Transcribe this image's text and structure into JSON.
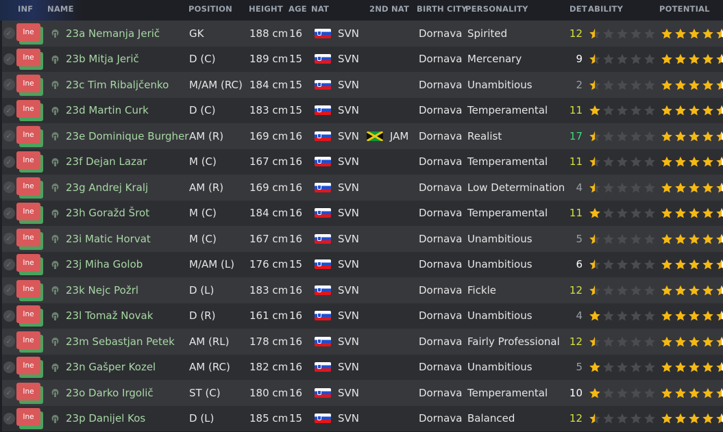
{
  "header": {
    "inf": "INF",
    "name": "NAME",
    "position": "POSITION",
    "height": "HEIGHT",
    "age": "AGE",
    "nat": "NAT",
    "nat2": "2ND NAT",
    "birth_city": "BIRTH CITY",
    "personality": "PERSONALITY",
    "det": "DET",
    "ability": "ABILITY",
    "potential": "POTENTIAL"
  },
  "colors": {
    "det_high": "#3fdc7a",
    "det_mid": "#d4e23c",
    "det_low": "#9aa0a6",
    "det_neutral": "#ffffff",
    "star_gold": "#f5b914",
    "star_empty": "#4a4c50",
    "star_white": "#ffffff",
    "name_green": "#a8d8a5",
    "inf_badge": "#d9585a"
  },
  "players": [
    {
      "inf": "Ine",
      "name": "23a Nemanja Jerič",
      "position": "GK",
      "height": "188 cm",
      "age": "16",
      "nat": "SVN",
      "nat2": "",
      "city": "Dornava",
      "personality": "Spirited",
      "det": "12",
      "det_tone": "mid",
      "ability_stars": 0.5,
      "potential_stars": 4.5
    },
    {
      "inf": "Ine",
      "name": "23b Mitja Jerič",
      "position": "D (C)",
      "height": "189 cm",
      "age": "15",
      "nat": "SVN",
      "nat2": "",
      "city": "Dornava",
      "personality": "Mercenary",
      "det": "9",
      "det_tone": "neutral",
      "ability_stars": 0.5,
      "potential_stars": 4.5
    },
    {
      "inf": "Ine",
      "name": "23c Tim Ribaljčenko",
      "position": "M/AM (RC)",
      "height": "184 cm",
      "age": "15",
      "nat": "SVN",
      "nat2": "",
      "city": "Dornava",
      "personality": "Unambitious",
      "det": "2",
      "det_tone": "low",
      "ability_stars": 0.5,
      "potential_stars": 4.5
    },
    {
      "inf": "Ine",
      "name": "23d Martin Curk",
      "position": "D (C)",
      "height": "183 cm",
      "age": "15",
      "nat": "SVN",
      "nat2": "",
      "city": "Dornava",
      "personality": "Temperamental",
      "det": "11",
      "det_tone": "mid",
      "ability_stars": 1,
      "potential_stars": 4.5
    },
    {
      "inf": "Ine",
      "name": "23e Dominique Burgher",
      "position": "AM (R)",
      "height": "169 cm",
      "age": "16",
      "nat": "SVN",
      "nat2": "JAM",
      "city": "Dornava",
      "personality": "Realist",
      "det": "17",
      "det_tone": "high",
      "ability_stars": 0.5,
      "potential_stars": 4.5
    },
    {
      "inf": "Ine",
      "name": "23f Dejan Lazar",
      "position": "M (C)",
      "height": "167 cm",
      "age": "16",
      "nat": "SVN",
      "nat2": "",
      "city": "Dornava",
      "personality": "Temperamental",
      "det": "11",
      "det_tone": "mid",
      "ability_stars": 0.5,
      "potential_stars": 4.5
    },
    {
      "inf": "Ine",
      "name": "23g Andrej Kralj",
      "position": "AM (R)",
      "height": "169 cm",
      "age": "16",
      "nat": "SVN",
      "nat2": "",
      "city": "Dornava",
      "personality": "Low Determination",
      "det": "4",
      "det_tone": "low",
      "ability_stars": 0.5,
      "potential_stars": 4.5
    },
    {
      "inf": "Ine",
      "name": "23h Goraž​d Šrot",
      "position": "M (C)",
      "height": "184 cm",
      "age": "16",
      "nat": "SVN",
      "nat2": "",
      "city": "Dornava",
      "personality": "Temperamental",
      "det": "11",
      "det_tone": "mid",
      "ability_stars": 1,
      "potential_stars": 4.5
    },
    {
      "inf": "Ine",
      "name": "23i Matic Horvat",
      "position": "M (C)",
      "height": "167 cm",
      "age": "16",
      "nat": "SVN",
      "nat2": "",
      "city": "Dornava",
      "personality": "Unambitious",
      "det": "5",
      "det_tone": "low",
      "ability_stars": 0.5,
      "potential_stars": 4.5
    },
    {
      "inf": "Ine",
      "name": "23j Miha Golob",
      "position": "M/AM (L)",
      "height": "176 cm",
      "age": "15",
      "nat": "SVN",
      "nat2": "",
      "city": "Dornava",
      "personality": "Unambitious",
      "det": "6",
      "det_tone": "neutral",
      "ability_stars": 0.5,
      "potential_stars": 4.5
    },
    {
      "inf": "Ine",
      "name": "23k Nejc Požrl",
      "position": "D (L)",
      "height": "183 cm",
      "age": "16",
      "nat": "SVN",
      "nat2": "",
      "city": "Dornava",
      "personality": "Fickle",
      "det": "12",
      "det_tone": "mid",
      "ability_stars": 0.5,
      "potential_stars": 4.5
    },
    {
      "inf": "Ine",
      "name": "23l Tomaž Novak",
      "position": "D (R)",
      "height": "161 cm",
      "age": "16",
      "nat": "SVN",
      "nat2": "",
      "city": "Dornava",
      "personality": "Unambitious",
      "det": "4",
      "det_tone": "low",
      "ability_stars": 1,
      "potential_stars": 4.5
    },
    {
      "inf": "Ine",
      "name": "23m Sebastjan Petek",
      "position": "AM (RL)",
      "height": "178 cm",
      "age": "16",
      "nat": "SVN",
      "nat2": "",
      "city": "Dornava",
      "personality": "Fairly Professional",
      "det": "12",
      "det_tone": "mid",
      "ability_stars": 0.5,
      "potential_stars": 4.5
    },
    {
      "inf": "Ine",
      "name": "23n Gašper Kozel",
      "position": "AM (RC)",
      "height": "182 cm",
      "age": "16",
      "nat": "SVN",
      "nat2": "",
      "city": "Dornava",
      "personality": "Unambitious",
      "det": "5",
      "det_tone": "low",
      "ability_stars": 1,
      "potential_stars": 4.5
    },
    {
      "inf": "Ine",
      "name": "23o Darko Irgolič",
      "position": "ST (C)",
      "height": "180 cm",
      "age": "16",
      "nat": "SVN",
      "nat2": "",
      "city": "Dornava",
      "personality": "Temperamental",
      "det": "10",
      "det_tone": "neutral",
      "ability_stars": 1,
      "potential_stars": 4.5
    },
    {
      "inf": "Ine",
      "name": "23p Danijel Kos",
      "position": "D (L)",
      "height": "185 cm",
      "age": "15",
      "nat": "SVN",
      "nat2": "",
      "city": "Dornava",
      "personality": "Balanced",
      "det": "12",
      "det_tone": "mid",
      "ability_stars": 0.5,
      "potential_stars": 4.5
    }
  ]
}
